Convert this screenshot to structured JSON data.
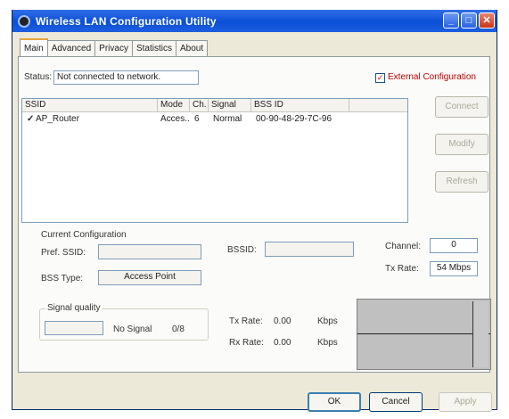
{
  "window": {
    "title": "Wireless LAN Configuration Utility",
    "min": "_",
    "max": "□",
    "close": "✕"
  },
  "tabs": [
    "Main",
    "Advanced",
    "Privacy",
    "Statistics",
    "About"
  ],
  "status": {
    "label": "Status:",
    "value": "Not connected to network.",
    "external_config_label": "External Configuration",
    "external_config_checked": true,
    "check_mark": "✓"
  },
  "network_list": {
    "columns": [
      "SSID",
      "Mode",
      "Ch.",
      "Signal",
      "BSS ID"
    ],
    "rows": [
      {
        "mark": "✓",
        "ssid": "AP_Router",
        "mode": "Acces...",
        "ch": "6",
        "signal": "Normal",
        "bssid": "00-90-48-29-7C-96"
      }
    ]
  },
  "side_buttons": [
    "Connect",
    "Modify",
    "Refresh"
  ],
  "current_config": {
    "title": "Current Configuration",
    "pref_ssid_label": "Pref. SSID:",
    "pref_ssid_value": "",
    "bssid_label": "BSSID:",
    "bssid_value": "",
    "channel_label": "Channel:",
    "channel_value": "0",
    "bss_type_label": "BSS Type:",
    "bss_type_value": "Access Point",
    "tx_rate_label": "Tx Rate:",
    "tx_rate_value": "54 Mbps"
  },
  "signal": {
    "title": "Signal quality",
    "value_text": "No Signal",
    "ratio": "0/8",
    "tx_label": "Tx Rate:",
    "tx_value": "0.00",
    "tx_unit": "Kbps",
    "rx_label": "Rx Rate:",
    "rx_value": "0.00",
    "rx_unit": "Kbps"
  },
  "footer": {
    "ok": "OK",
    "cancel": "Cancel",
    "apply": "Apply"
  },
  "colors": {
    "title_bar": "#0a4fd6",
    "external_config_text": "#c00000"
  }
}
